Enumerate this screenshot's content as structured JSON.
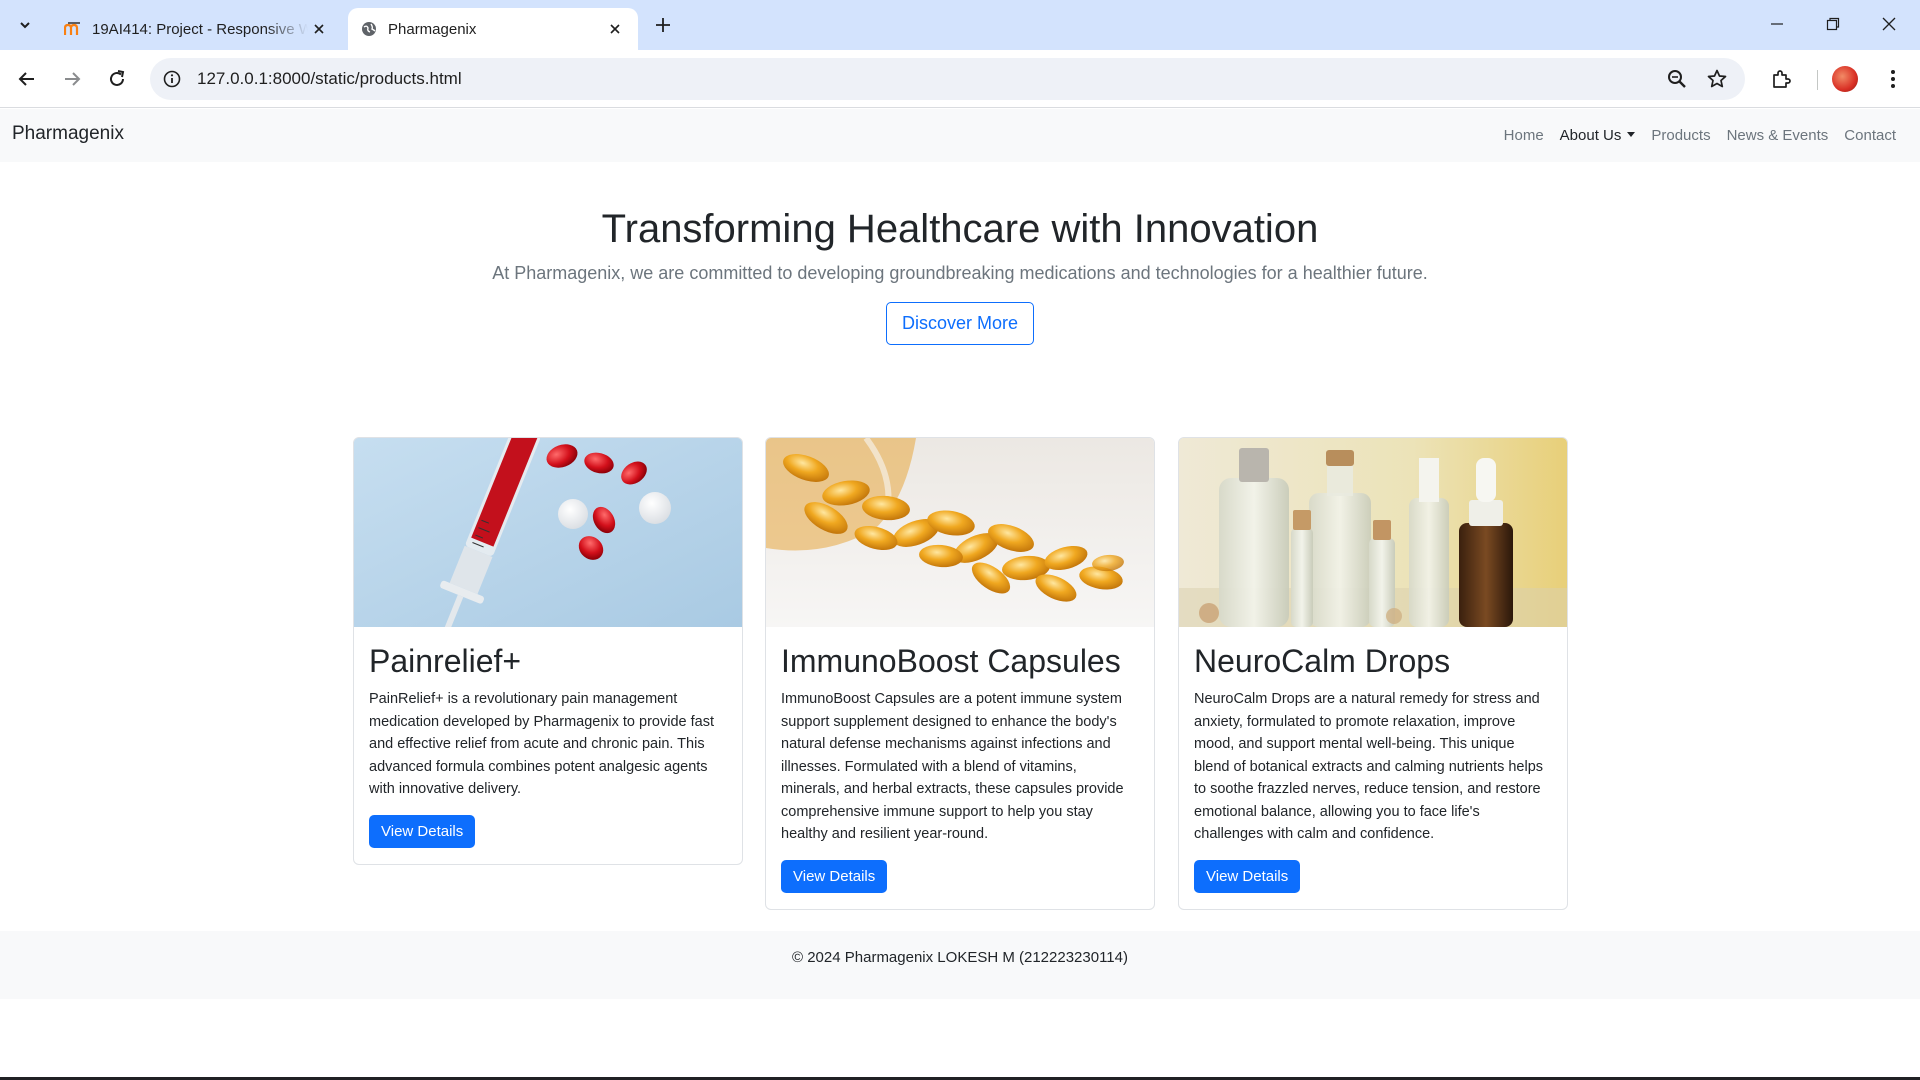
{
  "browser": {
    "tabs": [
      {
        "title": "19AI414: Project - Responsive Web",
        "active": false
      },
      {
        "title": "Pharmagenix",
        "active": true
      }
    ],
    "url": "127.0.0.1:8000/static/products.html"
  },
  "site": {
    "brand": "Pharmagenix",
    "nav": [
      "Home",
      "About Us",
      "Products",
      "News & Events",
      "Contact"
    ]
  },
  "hero": {
    "title": "Transforming Healthcare with Innovation",
    "subtitle": "At Pharmagenix, we are committed to developing groundbreaking medications and technologies for a healthier future.",
    "cta": "Discover More"
  },
  "products": [
    {
      "name": "Painrelief+",
      "description": "PainRelief+ is a revolutionary pain management medication developed by Pharmagenix to provide fast and effective relief from acute and chronic pain. This advanced formula combines potent analgesic agents with innovative delivery.",
      "button": "View Details",
      "image": "syringe-and-pills-image"
    },
    {
      "name": "ImmunoBoost Capsules",
      "description": "ImmunoBoost Capsules are a potent immune system support supplement designed to enhance the body's natural defense mechanisms against infections and illnesses. Formulated with a blend of vitamins, minerals, and herbal extracts, these capsules provide comprehensive immune support to help you stay healthy and resilient year-round.",
      "button": "View Details",
      "image": "gel-capsules-image"
    },
    {
      "name": "NeuroCalm Drops",
      "description": "NeuroCalm Drops are a natural remedy for stress and anxiety, formulated to promote relaxation, improve mood, and support mental well-being. This unique blend of botanical extracts and calming nutrients helps to soothe frazzled nerves, reduce tension, and restore emotional balance, allowing you to face life's challenges with calm and confidence.",
      "button": "View Details",
      "image": "glass-bottles-image"
    }
  ],
  "footer": "© 2024 Pharmagenix LOKESH M (212223230114)",
  "colors": {
    "primary": "#0d6efd",
    "navbar_bg": "#f8f9fa",
    "chrome_tabbar": "#d3e3fd"
  }
}
